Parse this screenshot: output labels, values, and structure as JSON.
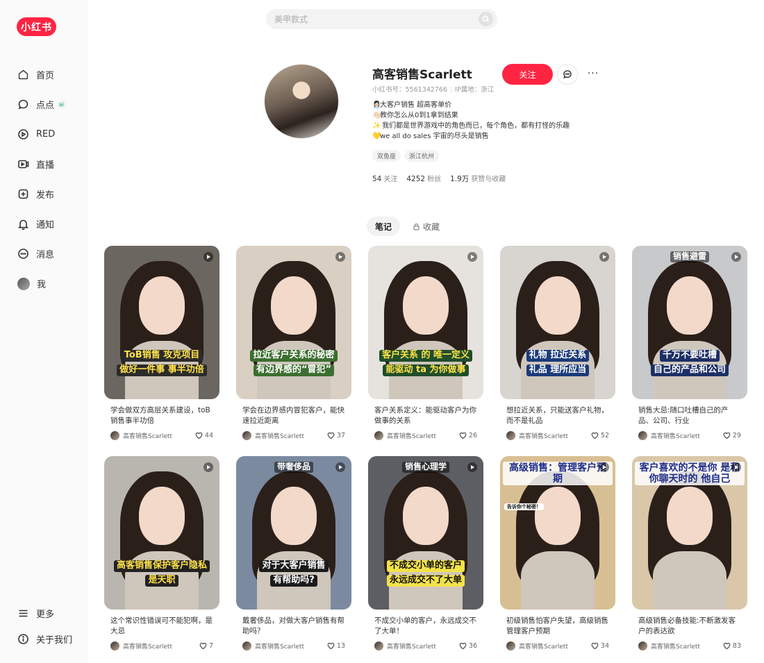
{
  "app": {
    "logo": "小红书"
  },
  "sidebar": {
    "items": [
      {
        "label": "首页",
        "icon": "home-icon"
      },
      {
        "label": "点点",
        "icon": "chat-bubble-icon",
        "badge": "ai"
      },
      {
        "label": "RED",
        "icon": "play-circle-icon"
      },
      {
        "label": "直播",
        "icon": "live-icon"
      },
      {
        "label": "发布",
        "icon": "plus-square-icon"
      },
      {
        "label": "通知",
        "icon": "bell-icon"
      },
      {
        "label": "消息",
        "icon": "message-icon"
      },
      {
        "label": "我",
        "icon": "avatar"
      }
    ],
    "bottom": [
      {
        "label": "更多",
        "icon": "menu-icon"
      },
      {
        "label": "关于我们",
        "icon": "info-icon"
      }
    ]
  },
  "search": {
    "placeholder": "美甲款式"
  },
  "profile": {
    "name": "高客销售Scarlett",
    "id_label": "小红书号：",
    "id_value": "5561342766",
    "ip_label": "IP属地：",
    "ip_value": "浙江",
    "follow_label": "关注",
    "bio": [
      {
        "emoji": "👩🏻‍💼",
        "text": "大客户销售 超高客单价"
      },
      {
        "emoji": "👋🏻",
        "text": "教你怎么从0到1拿到结果"
      },
      {
        "emoji": "✨",
        "text": " 我们都是世界游戏中的角色而已，每个角色，都有打怪的乐趣"
      },
      {
        "emoji": "💛",
        "text": "we all do sales 宇宙的尽头是销售"
      }
    ],
    "tags": [
      "双鱼座",
      "浙江杭州"
    ],
    "stats": [
      {
        "value": "54",
        "label": "关注"
      },
      {
        "value": "4252",
        "label": "粉丝"
      },
      {
        "value": "1.9万",
        "label": "获赞与收藏"
      }
    ]
  },
  "tabs": [
    {
      "label": "笔记",
      "active": true
    },
    {
      "label": "收藏",
      "active": false,
      "icon": "lock-icon"
    }
  ],
  "notes": [
    {
      "title": "学会做双方高层关系建设，toB销售事半功倍",
      "author": "高客销售Scarlett",
      "likes": "44",
      "overlay": [
        "ToB销售 攻克项目",
        "做好一件事 事半功倍"
      ],
      "bg": "#6b6660",
      "band": "#2b2b2b",
      "ocolor": "#ffe14a"
    },
    {
      "title": "学会在边界感内冒犯客户，能快速拉近距离",
      "author": "高客销售Scarlett",
      "likes": "37",
      "overlay": [
        "拉近客户关系的秘密",
        "有边界感的“冒犯”"
      ],
      "bg": "#d9cfc2",
      "band": "#3b6e2f",
      "ocolor": "#ffffff"
    },
    {
      "title": "客户关系定义：能驱动客户为你做事的关系",
      "author": "高客销售Scarlett",
      "likes": "26",
      "overlay": [
        "客户关系 的 唯一定义",
        "能驱动 ta 为你做事"
      ],
      "bg": "#e6e3de",
      "band": "#1f4e2a",
      "ocolor": "#ffe14a"
    },
    {
      "title": "想拉近关系，只能送客户礼物，而不是礼品",
      "author": "高客销售Scarlett",
      "likes": "52",
      "overlay": [
        "礼物 拉近关系",
        "礼品 理所应当"
      ],
      "bg": "#d8d4cf",
      "band": "#1a3a7a",
      "ocolor": "#ffffff"
    },
    {
      "title": "销售大忌:随口吐槽自己的产品、公司、行业",
      "author": "高客销售Scarlett",
      "likes": "29",
      "overlay": [
        "千万不要吐槽",
        "自己的产品和公司"
      ],
      "bg": "#c7c9cb",
      "band": "#1c2f66",
      "ocolor": "#ffffff",
      "top": "销售避雷"
    },
    {
      "title": "这个常识性错误可不能犯啊，是大忌",
      "author": "高客销售Scarlett",
      "likes": "7",
      "overlay": [
        "高客销售保护客户隐私",
        "是天职"
      ],
      "bg": "#b9b6b0",
      "band": "#222222",
      "ocolor": "#ffe14a"
    },
    {
      "title": "戴奢侈品，对做大客户销售有帮助吗？",
      "author": "高客销售Scarlett",
      "likes": "13",
      "overlay": [
        "对于大客户销售",
        "有帮助吗?"
      ],
      "bg": "#7c8aa0",
      "band": "#1b1b1b",
      "ocolor": "#ffffff",
      "top": "带奢侈品"
    },
    {
      "title": "不成交小单的客户，永远成交不了大单！",
      "author": "高客销售Scarlett",
      "likes": "36",
      "overlay": [
        "不成交小单的客户",
        "永远成交不了大单"
      ],
      "bg": "#5d5e63",
      "band": "#f2e24a",
      "ocolor": "#111111",
      "top": "销售心理学"
    },
    {
      "title": "初级销售怕客户失望，高级销售管理客户预期",
      "author": "高客销售Scarlett",
      "likes": "34",
      "overlay": [
        "",
        ""
      ],
      "bg": "#d8bf93",
      "band": "#d8bf93",
      "ocolor": "#ffffff",
      "top": "高级销售：管理客户预期",
      "caption": "告诉你个秘密！"
    },
    {
      "title": "高级销售必备技能:不断激发客户的表达欲",
      "author": "高客销售Scarlett",
      "likes": "83",
      "overlay": [
        "",
        ""
      ],
      "bg": "#d9c7a8",
      "band": "#d9c7a8",
      "ocolor": "#ffffff",
      "top": "客户喜欢的不是你 是和你聊天时的 他自己"
    }
  ]
}
